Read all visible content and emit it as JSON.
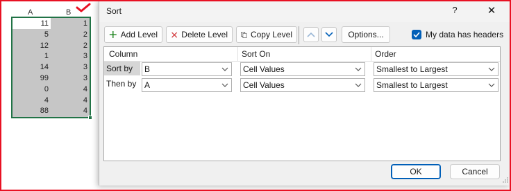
{
  "sheet": {
    "columns": [
      "A",
      "B"
    ],
    "rows": [
      {
        "a": "11",
        "b": "1"
      },
      {
        "a": "5",
        "b": "2"
      },
      {
        "a": "12",
        "b": "2"
      },
      {
        "a": "1",
        "b": "3"
      },
      {
        "a": "14",
        "b": "3"
      },
      {
        "a": "99",
        "b": "3"
      },
      {
        "a": "0",
        "b": "4"
      },
      {
        "a": "4",
        "b": "4"
      },
      {
        "a": "88",
        "b": "4"
      }
    ],
    "annotation_color": "#e81123",
    "selection_color": "#217346"
  },
  "dialog": {
    "title": "Sort",
    "help": "?",
    "close": "✕",
    "toolbar": {
      "add_level": "Add Level",
      "delete_level": "Delete Level",
      "copy_level": "Copy Level",
      "options": "Options...",
      "my_data_has_headers": "My data has headers",
      "headers_checked": true
    },
    "grid": {
      "headers": {
        "column": "Column",
        "sort_on": "Sort On",
        "order": "Order"
      },
      "levels": [
        {
          "label": "Sort by",
          "column": "B",
          "sort_on": "Cell Values",
          "order": "Smallest to Largest",
          "selected": true
        },
        {
          "label": "Then by",
          "column": "A",
          "sort_on": "Cell Values",
          "order": "Smallest to Largest",
          "selected": false
        }
      ]
    },
    "ok": "OK",
    "cancel": "Cancel",
    "accent_color": "#005fb8"
  }
}
